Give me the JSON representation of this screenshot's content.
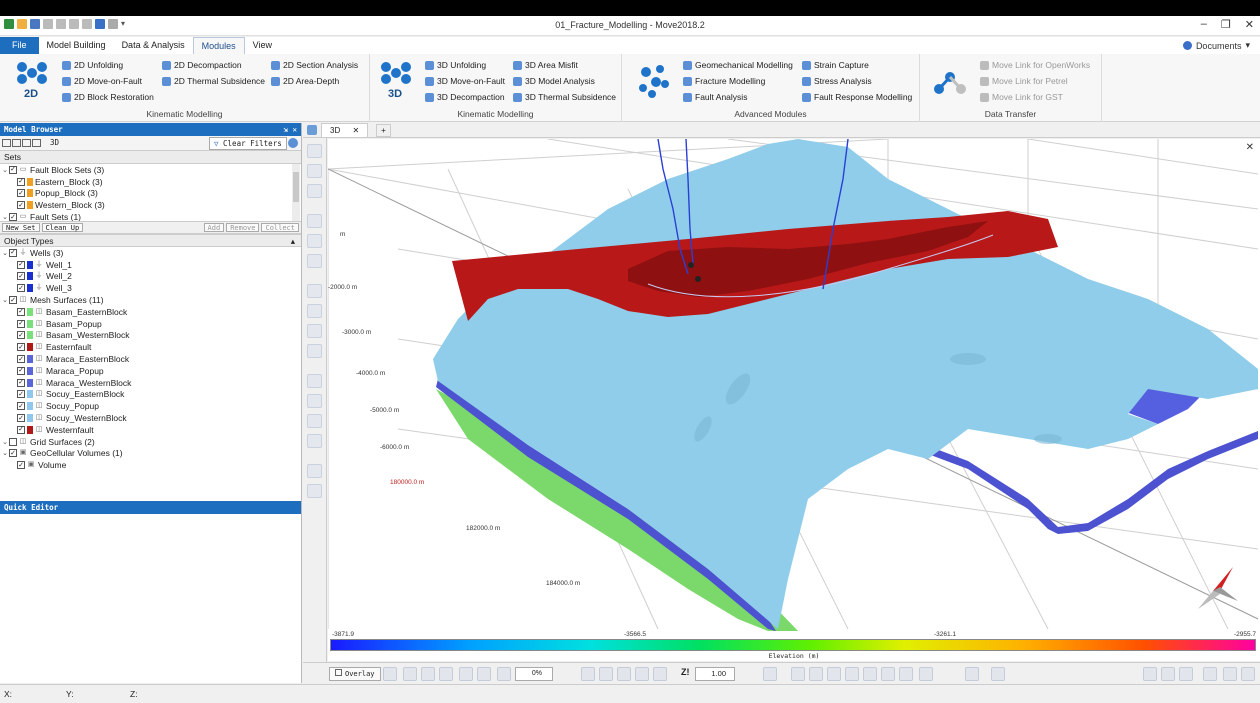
{
  "window": {
    "title": "01_Fracture_Modelling - Move2018.2",
    "minimize": "‒",
    "restore": "❐",
    "close": "✕"
  },
  "menu": {
    "file": "File",
    "items": [
      "Model Building",
      "Data & Analysis",
      "Modules",
      "View"
    ],
    "active": "Modules",
    "documents": "Documents",
    "dropdown": "▾"
  },
  "ribbon": {
    "group2d": {
      "badge": "2D",
      "items": [
        "2D Unfolding",
        "2D Move-on-Fault",
        "2D Block Restoration",
        "2D Decompaction",
        "2D Thermal Subsidence",
        "2D Section Analysis",
        "2D Area-Depth"
      ],
      "label": "Kinematic Modelling"
    },
    "group3d": {
      "badge": "3D",
      "items": [
        "3D Unfolding",
        "3D Move-on-Fault",
        "3D Decompaction",
        "3D Area Misfit",
        "3D Model Analysis",
        "3D Thermal Subsidence"
      ],
      "label": "Kinematic Modelling"
    },
    "advanced": {
      "items": [
        "Geomechanical Modelling",
        "Fracture Modelling",
        "Fault Analysis",
        "Strain Capture",
        "Stress Analysis",
        "Fault Response Modelling"
      ],
      "label": "Advanced Modules"
    },
    "transfer": {
      "items": [
        "Move Link for OpenWorks",
        "Move Link for Petrel",
        "Move Link for GST"
      ],
      "label": "Data Transfer"
    }
  },
  "model_browser": {
    "title": "Model Browser",
    "view_label": "3D",
    "clear_filters": "Clear Filters",
    "sets_header": "Sets",
    "sets": [
      {
        "label": "Fault Block Sets (3)",
        "level": 0
      },
      {
        "label": "Eastern_Block (3)",
        "level": 1,
        "color": "#f0a020"
      },
      {
        "label": "Popup_Block (3)",
        "level": 1,
        "color": "#f0a020"
      },
      {
        "label": "Western_Block (3)",
        "level": 1,
        "color": "#f0a020"
      },
      {
        "label": "Fault Sets (1)",
        "level": 0
      }
    ],
    "buttons": [
      "New Set",
      "Clean Up",
      "Add",
      "Remove",
      "Collect"
    ],
    "object_types_header": "Object Types",
    "objects": [
      {
        "label": "Wells (3)",
        "level": 0,
        "icon": "well-icon"
      },
      {
        "label": "Well_1",
        "level": 1,
        "color": "#1a2fd0",
        "icon": "well-icon"
      },
      {
        "label": "Well_2",
        "level": 1,
        "color": "#1a2fd0",
        "icon": "well-icon"
      },
      {
        "label": "Well_3",
        "level": 1,
        "color": "#1a2fd0",
        "icon": "well-icon"
      },
      {
        "label": "Mesh Surfaces (11)",
        "level": 0,
        "icon": "mesh-icon"
      },
      {
        "label": "Basam_EasternBlock",
        "level": 1,
        "color": "#7be07b",
        "icon": "mesh-icon"
      },
      {
        "label": "Basam_Popup",
        "level": 1,
        "color": "#7be07b",
        "icon": "mesh-icon"
      },
      {
        "label": "Basam_WesternBlock",
        "level": 1,
        "color": "#7be07b",
        "icon": "mesh-icon"
      },
      {
        "label": "Easternfault",
        "level": 1,
        "color": "#b01818",
        "icon": "mesh-icon"
      },
      {
        "label": "Maraca_EasternBlock",
        "level": 1,
        "color": "#5a66d8",
        "icon": "mesh-icon"
      },
      {
        "label": "Maraca_Popup",
        "level": 1,
        "color": "#5a66d8",
        "icon": "mesh-icon"
      },
      {
        "label": "Maraca_WesternBlock",
        "level": 1,
        "color": "#5a66d8",
        "icon": "mesh-icon"
      },
      {
        "label": "Socuy_EasternBlock",
        "level": 1,
        "color": "#8fc8ee",
        "icon": "mesh-icon"
      },
      {
        "label": "Socuy_Popup",
        "level": 1,
        "color": "#8fc8ee",
        "icon": "mesh-icon"
      },
      {
        "label": "Socuy_WesternBlock",
        "level": 1,
        "color": "#8fc8ee",
        "icon": "mesh-icon"
      },
      {
        "label": "Westernfault",
        "level": 1,
        "color": "#b01818",
        "icon": "mesh-icon"
      },
      {
        "label": "Grid Surfaces (2)",
        "level": 0,
        "icon": "grid-icon",
        "unchecked": true
      },
      {
        "label": "GeoCellular Volumes (1)",
        "level": 0,
        "icon": "volume-icon"
      },
      {
        "label": "Volume",
        "level": 1,
        "icon": "volume-icon"
      }
    ]
  },
  "quick_editor": {
    "title": "Quick Editor"
  },
  "view_tab": {
    "label": "3D",
    "close": "✕",
    "add": "+"
  },
  "viewport": {
    "close": "✕",
    "depth_labels": [
      "-2000.0 m",
      "-3000.0 m",
      "-4000.0 m",
      "-5000.0 m",
      "-6000.0 m"
    ],
    "tick_top": "m",
    "easting_labels": [
      "180000.0 m",
      "182000.0 m",
      "184000.0 m"
    ]
  },
  "colorbar": {
    "min": "-3871.9",
    "q1": "-3566.5",
    "q3": "-3261.1",
    "max": "-2955.7",
    "title": "Elevation (m)"
  },
  "bottom_toolbar": {
    "overlay": "Overlay",
    "opacity": "0%",
    "z_label": "Z!",
    "z_value": "1.00"
  },
  "status": {
    "x": "X:",
    "y": "Y:",
    "z": "Z:"
  },
  "colors": {
    "accent": "#1e6ebf",
    "surface": "#8fcdea",
    "fault": "#b01818",
    "basement": "#7be07b",
    "maraca": "#5a66d8"
  }
}
